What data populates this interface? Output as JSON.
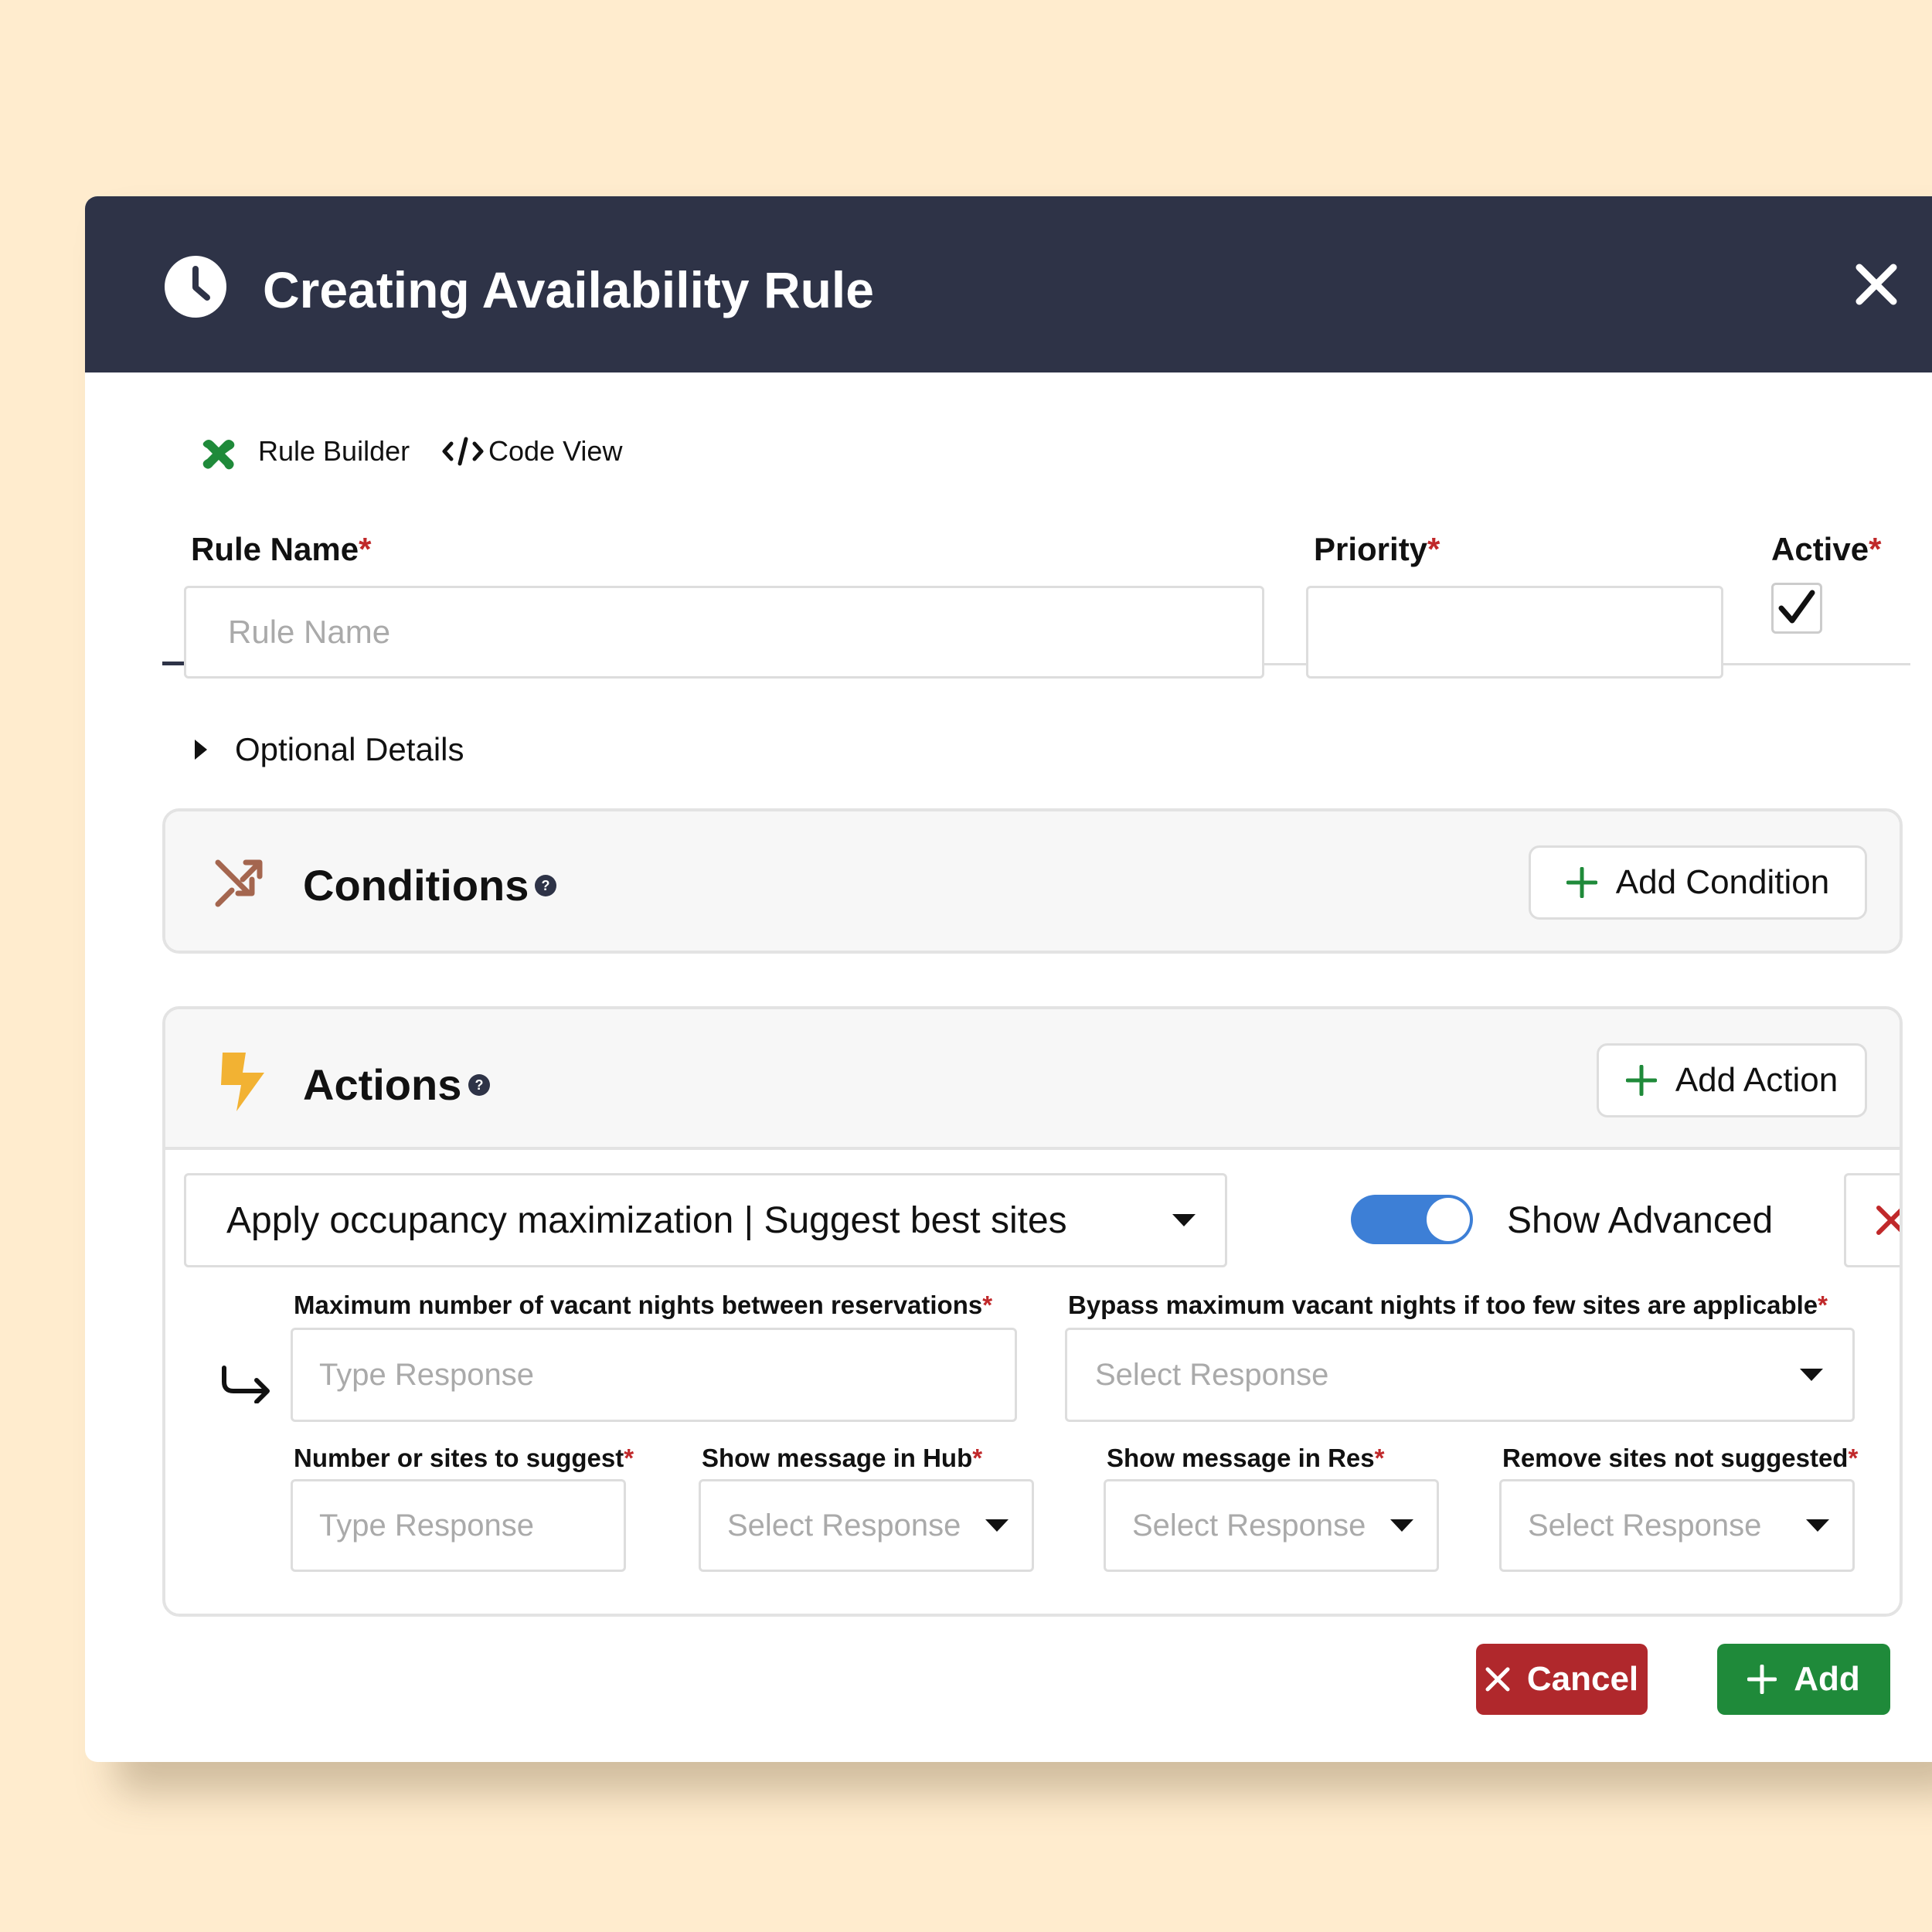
{
  "header": {
    "title": "Creating Availability Rule"
  },
  "tabs": [
    {
      "label": "Rule Builder",
      "active": true
    },
    {
      "label": "Code View",
      "active": false
    }
  ],
  "form": {
    "rule_name_label": "Rule Name",
    "rule_name_placeholder": "Rule Name",
    "priority_label": "Priority",
    "active_label": "Active",
    "active_checked": true,
    "required_mark": "*",
    "optional_details": "Optional Details"
  },
  "conditions": {
    "title": "Conditions",
    "add_label": "Add Condition"
  },
  "actions": {
    "title": "Actions",
    "add_label": "Add Action",
    "selected_action": "Apply occupancy maximization | Suggest best sites",
    "show_advanced_label": "Show Advanced",
    "show_advanced_on": true,
    "fields": [
      {
        "label": "Maximum number of vacant nights between reservations",
        "placeholder": "Type Response"
      },
      {
        "label": "Bypass maximum vacant nights if too few sites are applicable",
        "placeholder": "Select Response"
      },
      {
        "label": "Number or sites to suggest",
        "placeholder": "Type Response"
      },
      {
        "label": "Show message in Hub",
        "placeholder": "Select Response"
      },
      {
        "label": "Show message in Res",
        "placeholder": "Select Response"
      },
      {
        "label": "Remove sites not suggested",
        "placeholder": "Select Response"
      }
    ]
  },
  "footer": {
    "cancel_label": "Cancel",
    "add_label": "Add"
  },
  "colors": {
    "header_bg": "#2e3347",
    "required": "#c0282a",
    "cancel": "#b0282c",
    "add": "#1f8a3a",
    "toggle": "#3d7fd6",
    "conditions_icon": "#a4664f",
    "actions_icon": "#f2b233"
  },
  "icons": {
    "header": "clock-icon",
    "close": "close-icon",
    "rule_builder_tab": "puzzle-icon",
    "code_view_tab": "code-icon",
    "optional_toggle": "caret-right-icon",
    "conditions": "shuffle-icon",
    "actions": "lightning-bolt-icon",
    "help": "help-icon",
    "add": "plus-icon",
    "remove": "x-icon",
    "subrow": "arrow-turn-down-right-icon",
    "dropdown": "caret-down-icon"
  }
}
